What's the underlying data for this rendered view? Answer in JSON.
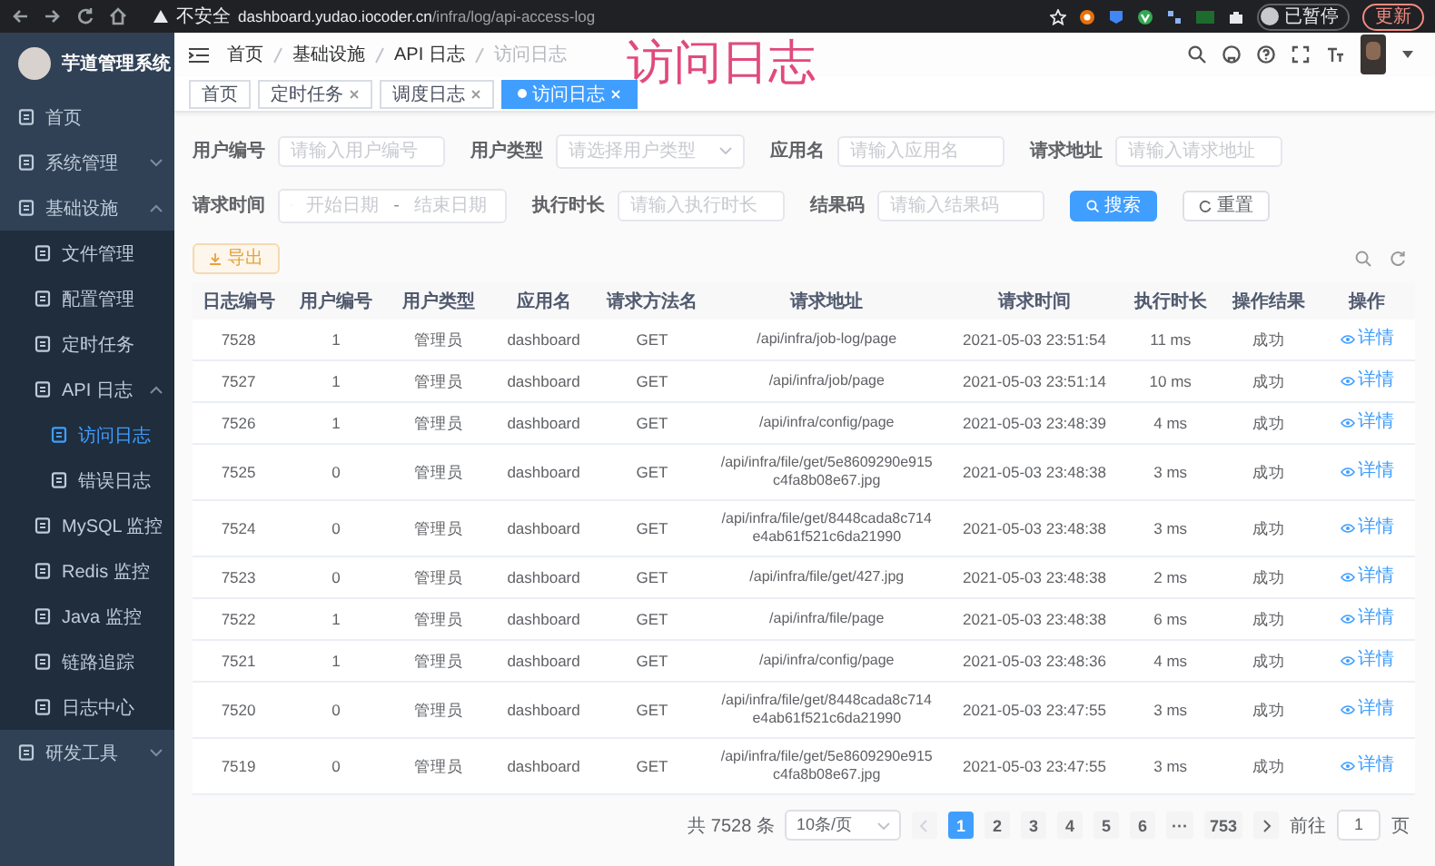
{
  "browser": {
    "security": "不安全",
    "url_host": "dashboard.yudao.iocoder.cn",
    "url_path": "/infra/log/api-access-log",
    "profile": "已暂停",
    "update": "更新"
  },
  "annotation": "访问日志",
  "sidebar": {
    "title": "芋道管理系统",
    "items": [
      {
        "label": "首页",
        "selected": false
      },
      {
        "label": "系统管理",
        "selected": false,
        "expanded": false
      },
      {
        "label": "基础设施",
        "selected": false,
        "expanded": true,
        "children": [
          {
            "label": "文件管理",
            "selected": false
          },
          {
            "label": "配置管理",
            "selected": false
          },
          {
            "label": "定时任务",
            "selected": false
          },
          {
            "label": "API 日志",
            "selected": false,
            "expanded": true,
            "children": [
              {
                "label": "访问日志",
                "selected": true
              },
              {
                "label": "错误日志",
                "selected": false
              }
            ]
          },
          {
            "label": "MySQL 监控",
            "selected": false
          },
          {
            "label": "Redis 监控",
            "selected": false
          },
          {
            "label": "Java 监控",
            "selected": false
          },
          {
            "label": "链路追踪",
            "selected": false
          },
          {
            "label": "日志中心",
            "selected": false
          }
        ]
      },
      {
        "label": "研发工具",
        "selected": false,
        "expanded": false
      }
    ]
  },
  "breadcrumb": [
    {
      "label": "首页",
      "current": false
    },
    {
      "label": "基础设施",
      "current": false
    },
    {
      "label": "API 日志",
      "current": false
    },
    {
      "label": "访问日志",
      "current": true
    }
  ],
  "tags": [
    {
      "label": "首页",
      "selected": false,
      "closable": false
    },
    {
      "label": "定时任务",
      "selected": false,
      "closable": true
    },
    {
      "label": "调度日志",
      "selected": false,
      "closable": true
    },
    {
      "label": "访问日志",
      "selected": true,
      "closable": true
    }
  ],
  "filters": [
    [
      {
        "label": "用户编号",
        "kind": "input",
        "placeholder": "请输入用户编号"
      },
      {
        "label": "用户类型",
        "kind": "select",
        "placeholder": "请选择用户类型"
      },
      {
        "label": "应用名",
        "kind": "input",
        "placeholder": "请输入应用名"
      },
      {
        "label": "请求地址",
        "kind": "input",
        "placeholder": "请输入请求地址"
      }
    ],
    [
      {
        "label": "请求时间",
        "kind": "daterange",
        "start_placeholder": "开始日期",
        "separator": "-",
        "end_placeholder": "结束日期"
      },
      {
        "label": "执行时长",
        "kind": "input",
        "placeholder": "请输入执行时长"
      },
      {
        "label": "结果码",
        "kind": "input",
        "placeholder": "请输入结果码"
      }
    ]
  ],
  "search_button": "搜索",
  "reset_button": "重置",
  "export_button": "导出",
  "table": {
    "columns": [
      {
        "label": "日志编号",
        "kind": "text"
      },
      {
        "label": "用户编号",
        "kind": "text"
      },
      {
        "label": "用户类型",
        "kind": "text"
      },
      {
        "label": "应用名",
        "kind": "text"
      },
      {
        "label": "请求方法名",
        "kind": "text"
      },
      {
        "label": "请求地址",
        "kind": "url"
      },
      {
        "label": "请求时间",
        "kind": "time"
      },
      {
        "label": "执行时长",
        "kind": "text"
      },
      {
        "label": "操作结果",
        "kind": "text"
      },
      {
        "label": "操作",
        "kind": "action"
      }
    ],
    "rows": [
      [
        "7528",
        "1",
        "管理员",
        "dashboard",
        "GET",
        "/api/infra/job-log/page",
        "2021-05-03 23:51:54",
        "11 ms",
        "成功",
        "详情"
      ],
      [
        "7527",
        "1",
        "管理员",
        "dashboard",
        "GET",
        "/api/infra/job/page",
        "2021-05-03 23:51:14",
        "10 ms",
        "成功",
        "详情"
      ],
      [
        "7526",
        "1",
        "管理员",
        "dashboard",
        "GET",
        "/api/infra/config/page",
        "2021-05-03 23:48:39",
        "4 ms",
        "成功",
        "详情"
      ],
      [
        "7525",
        "0",
        "管理员",
        "dashboard",
        "GET",
        "/api/infra/file/get/5e8609290e915c4fa8b08e67.jpg",
        "2021-05-03 23:48:38",
        "3 ms",
        "成功",
        "详情"
      ],
      [
        "7524",
        "0",
        "管理员",
        "dashboard",
        "GET",
        "/api/infra/file/get/8448cada8c714e4ab61f521c6da21990",
        "2021-05-03 23:48:38",
        "3 ms",
        "成功",
        "详情"
      ],
      [
        "7523",
        "0",
        "管理员",
        "dashboard",
        "GET",
        "/api/infra/file/get/427.jpg",
        "2021-05-03 23:48:38",
        "2 ms",
        "成功",
        "详情"
      ],
      [
        "7522",
        "1",
        "管理员",
        "dashboard",
        "GET",
        "/api/infra/file/page",
        "2021-05-03 23:48:38",
        "6 ms",
        "成功",
        "详情"
      ],
      [
        "7521",
        "1",
        "管理员",
        "dashboard",
        "GET",
        "/api/infra/config/page",
        "2021-05-03 23:48:36",
        "4 ms",
        "成功",
        "详情"
      ],
      [
        "7520",
        "0",
        "管理员",
        "dashboard",
        "GET",
        "/api/infra/file/get/8448cada8c714e4ab61f521c6da21990",
        "2021-05-03 23:47:55",
        "3 ms",
        "成功",
        "详情"
      ],
      [
        "7519",
        "0",
        "管理员",
        "dashboard",
        "GET",
        "/api/infra/file/get/5e8609290e915c4fa8b08e67.jpg",
        "2021-05-03 23:47:55",
        "3 ms",
        "成功",
        "详情"
      ]
    ]
  },
  "pagination": {
    "total": "共 7528 条",
    "page_size": "10条/页",
    "pages": [
      {
        "label": "1",
        "selected": true
      },
      {
        "label": "2",
        "selected": false
      },
      {
        "label": "3",
        "selected": false
      },
      {
        "label": "4",
        "selected": false
      },
      {
        "label": "5",
        "selected": false
      },
      {
        "label": "6",
        "selected": false
      },
      {
        "label": "···",
        "selected": false
      },
      {
        "label": "753",
        "selected": false
      }
    ],
    "goto_label": "前往",
    "goto_value": "1",
    "goto_unit": "页"
  }
}
